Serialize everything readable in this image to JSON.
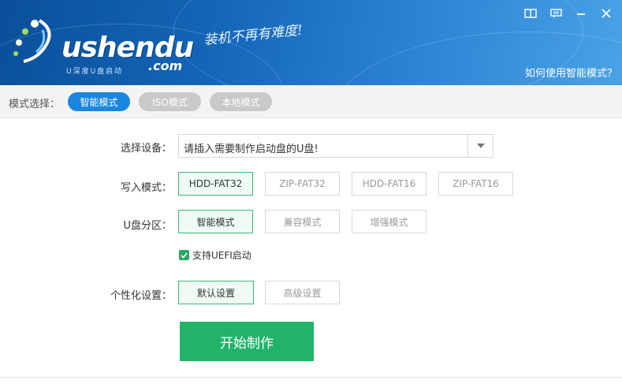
{
  "header": {
    "logo_main": "ushendu",
    "logo_com": ".com",
    "logo_sub": "U深度U盘启动",
    "slogan": "装机不再有难度!",
    "help_link": "如何使用智能模式？",
    "window_buttons": [
      "book-icon",
      "message-icon",
      "minimize-icon",
      "close-icon"
    ]
  },
  "modebar": {
    "label": "模式选择：",
    "modes": [
      {
        "label": "智能模式",
        "active": true
      },
      {
        "label": "ISO模式",
        "active": false
      },
      {
        "label": "本地模式",
        "active": false
      }
    ]
  },
  "form": {
    "device_label": "选择设备：",
    "device_value": "请插入需要制作启动盘的U盘!",
    "write_mode_label": "写入模式：",
    "write_modes": [
      "HDD-FAT32",
      "ZIP-FAT32",
      "HDD-FAT16",
      "ZIP-FAT16"
    ],
    "write_mode_selected": "HDD-FAT32",
    "partition_label": "U盘分区：",
    "partitions": [
      "智能模式",
      "兼容模式",
      "增强模式"
    ],
    "partition_selected": "智能模式",
    "uefi_label": "支持UEFI启动",
    "uefi_checked": true,
    "personalize_label": "个性化设置：",
    "personalize_options": [
      "默认设置",
      "高级设置"
    ],
    "personalize_selected": "默认设置",
    "start_button": "开始制作"
  },
  "colors": {
    "accent_blue": "#1a86e0",
    "accent_green": "#22b36b",
    "selected_border": "#3cba7a"
  }
}
